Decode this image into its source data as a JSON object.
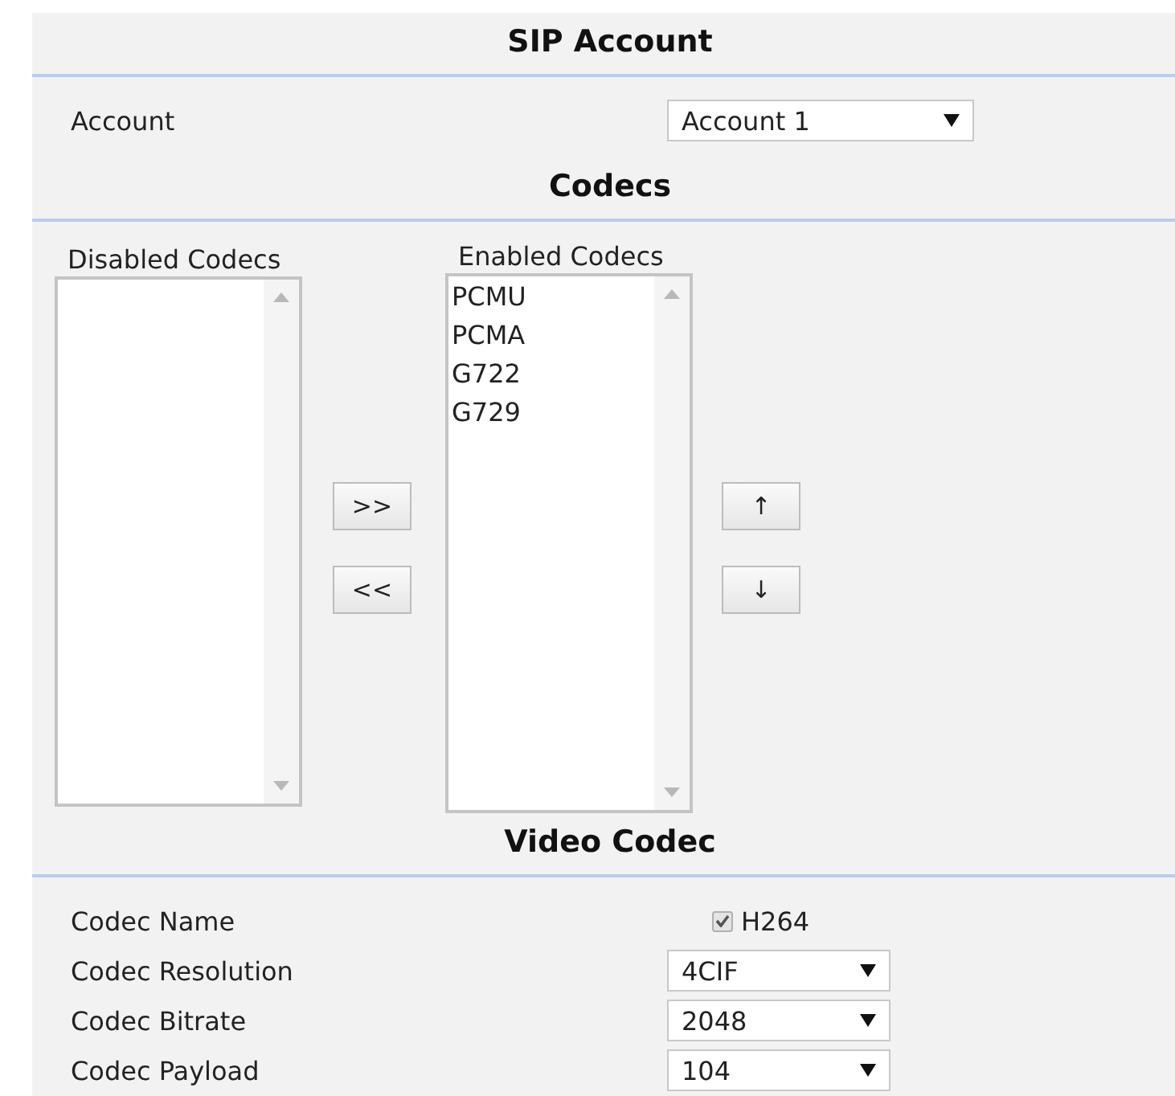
{
  "sip_account": {
    "title": "SIP Account",
    "account": {
      "label": "Account",
      "value": "Account 1"
    }
  },
  "codecs": {
    "title": "Codecs",
    "disabled_list": {
      "label": "Disabled Codecs"
    },
    "enabled_list": {
      "label": "Enabled Codecs",
      "items": [
        "PCMU",
        "PCMA",
        "G722",
        "G729"
      ]
    },
    "move_buttons": [
      ">>",
      "<<"
    ],
    "order_buttons": [
      "↑",
      "↓"
    ]
  },
  "video_codec": {
    "title": "Video Codec",
    "rows": [
      {
        "kind": "checkbox",
        "label": "Codec Name",
        "value": "H264",
        "checked": true,
        "disabled": true
      },
      {
        "kind": "select",
        "label": "Codec Resolution",
        "value": "4CIF"
      },
      {
        "kind": "select",
        "label": "Codec Bitrate",
        "value": "2048"
      },
      {
        "kind": "select",
        "label": "Codec Payload",
        "value": "104"
      }
    ]
  }
}
